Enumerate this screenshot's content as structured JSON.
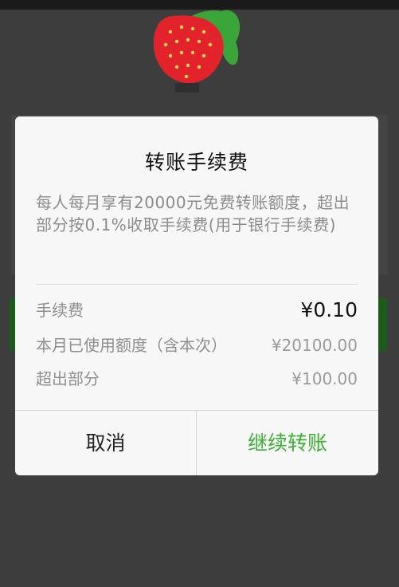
{
  "dialog": {
    "title": "转账手续费",
    "description": "每人每月享有20000元免费转账额度，超出部分按0.1%收取手续费(用于银行手续费)",
    "rows": [
      {
        "label": "手续费",
        "value": "¥0.10"
      },
      {
        "label": "本月已使用额度（含本次）",
        "value": "¥20100.00"
      },
      {
        "label": "超出部分",
        "value": "¥100.00"
      }
    ],
    "buttons": {
      "cancel": "取消",
      "continue": "继续转账"
    }
  },
  "colors": {
    "accent": "#3cb034",
    "overlay": "#3d3d3d",
    "dialog_bg": "#f7f7f7",
    "strawberry": "#e3232c",
    "leaf": "#3aa63a"
  },
  "icons": {
    "avatar": "strawberry-icon"
  }
}
